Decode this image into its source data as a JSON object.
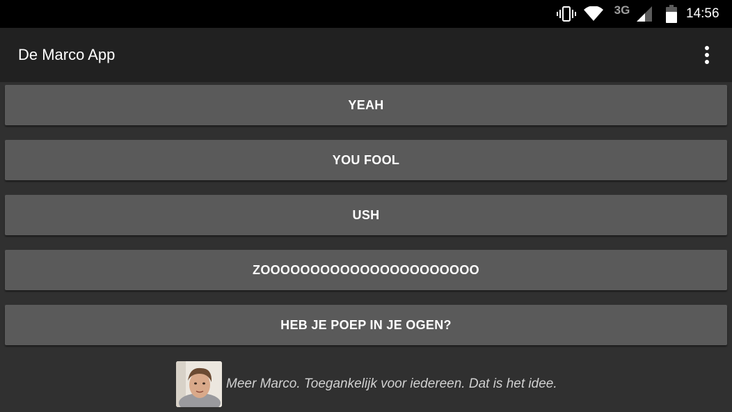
{
  "status_bar": {
    "network_type": "3G",
    "time": "14:56",
    "icons": [
      "vibrate-icon",
      "wifi-icon",
      "signal-icon",
      "battery-icon"
    ]
  },
  "app_bar": {
    "title": "De Marco App",
    "overflow_icon": "more-vert-icon"
  },
  "buttons": [
    {
      "label": "YEAH"
    },
    {
      "label": "YOU FOOL"
    },
    {
      "label": "USH"
    },
    {
      "label": "ZOOOOOOOOOOOOOOOOOOOOOO"
    },
    {
      "label": "HEB JE POEP IN JE OGEN?"
    }
  ],
  "footer": {
    "tagline": "Meer Marco. Toegankelijk voor iedereen. Dat is het idee."
  },
  "colors": {
    "status_bar": "#000000",
    "app_bar": "#212121",
    "background": "#303030",
    "button": "#5a5a5a",
    "text": "#ffffff"
  }
}
